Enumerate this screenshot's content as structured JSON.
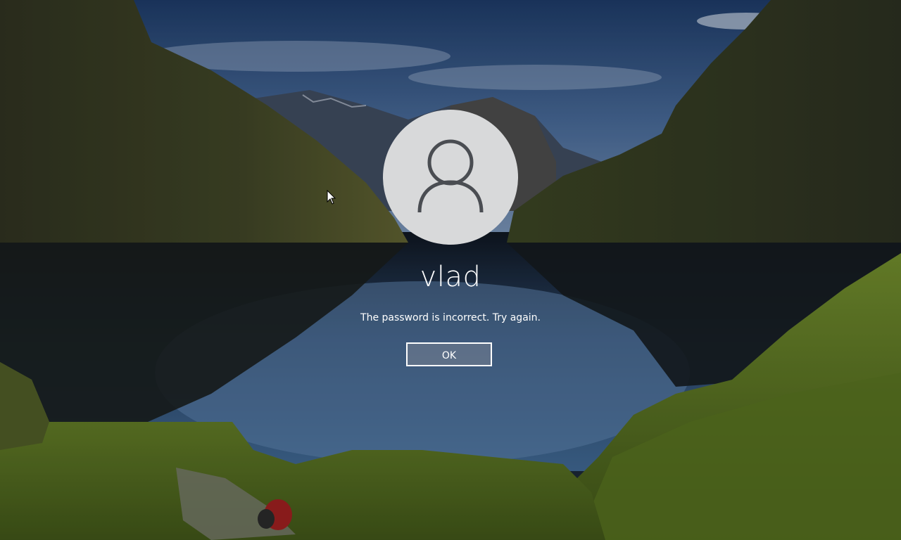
{
  "lock_screen": {
    "username": "vlad",
    "message": "The password is incorrect. Try again.",
    "ok_label": "OK",
    "avatar_icon": "user-icon"
  },
  "colors": {
    "text": "#ffffff",
    "avatar_bg": "#d8d9da",
    "avatar_glyph": "#4a4d52"
  }
}
